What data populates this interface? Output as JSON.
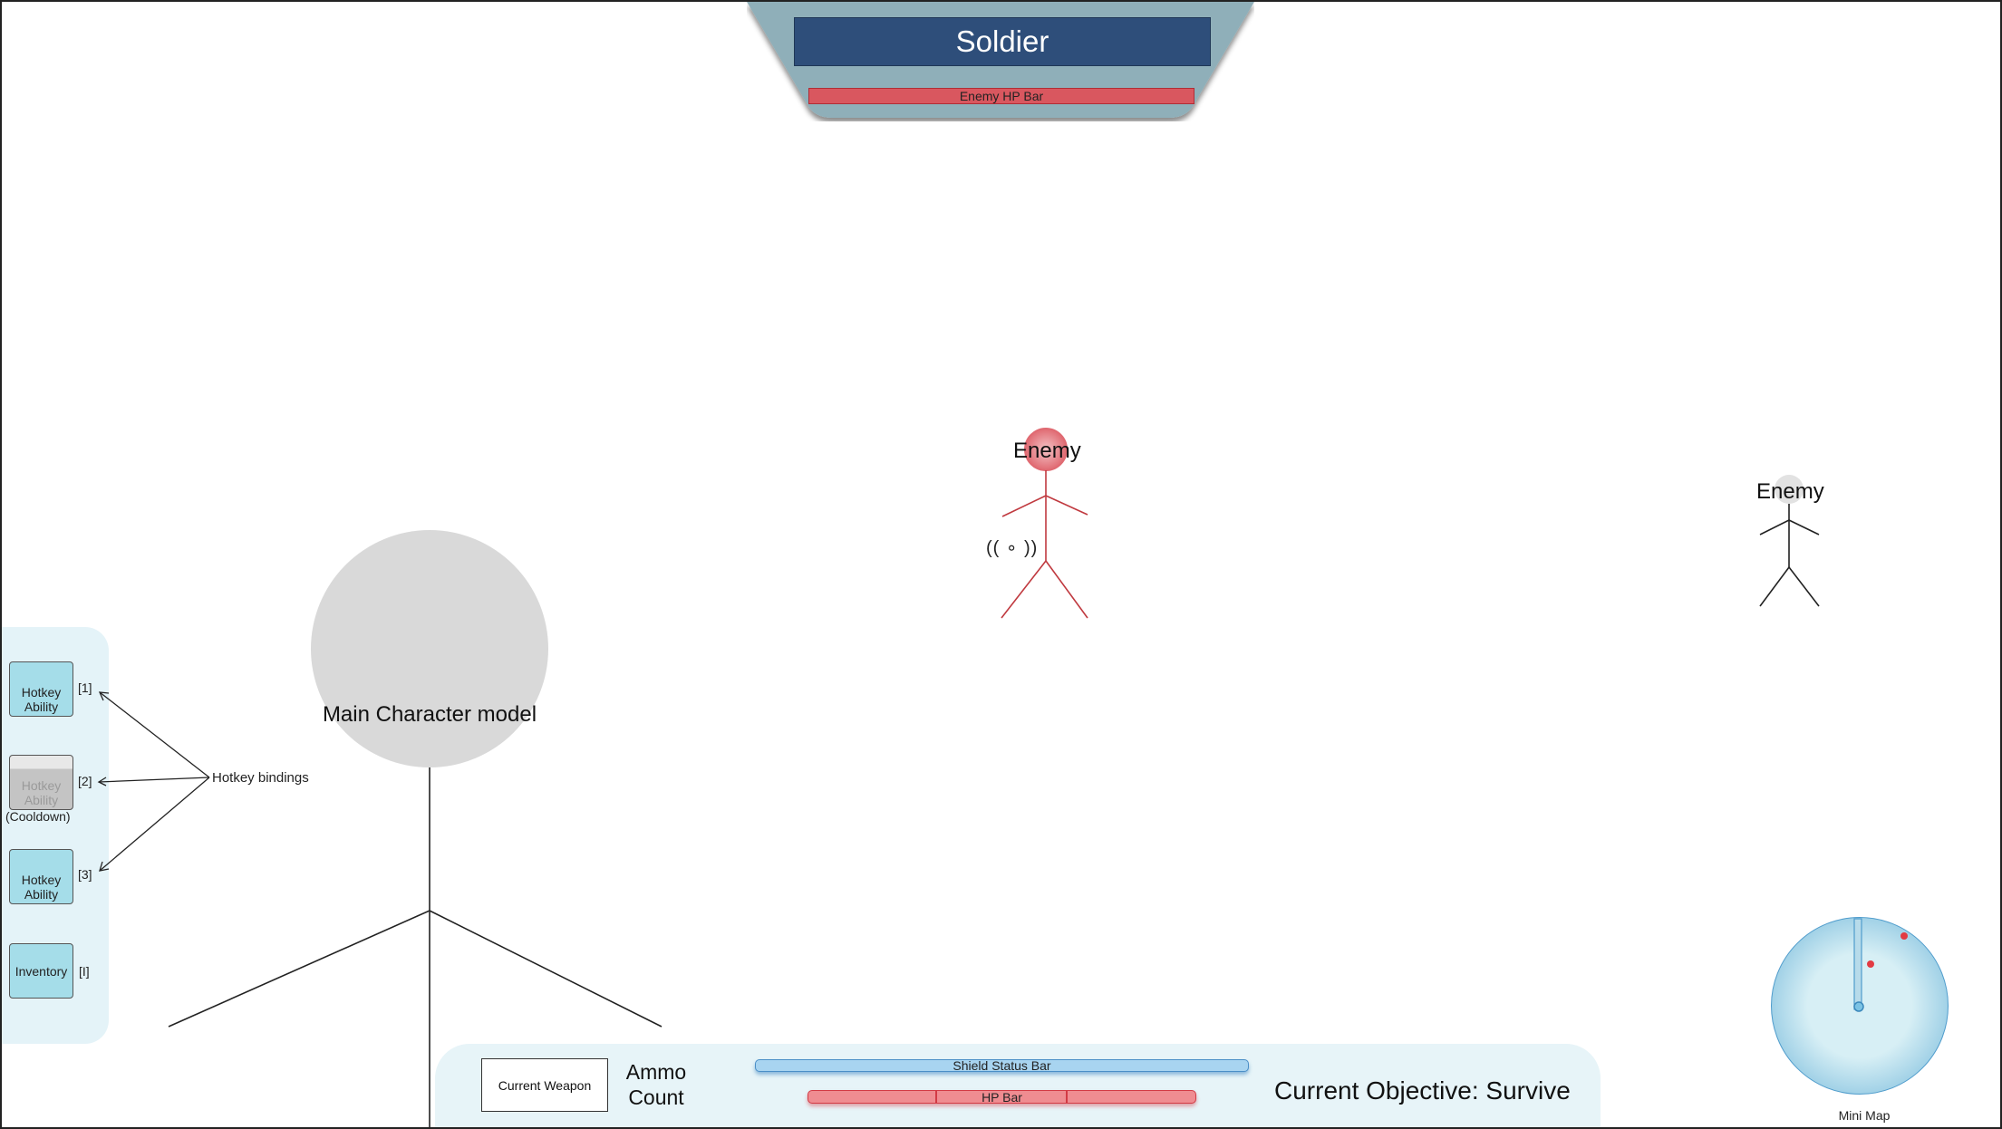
{
  "target": {
    "name": "Soldier",
    "hp_label": "Enemy HP Bar"
  },
  "enemies": [
    {
      "label": "Enemy",
      "state": "targeted"
    },
    {
      "label": "Enemy",
      "state": "idle"
    }
  ],
  "ammo_indicator": "(( ∘ ))",
  "main_character": {
    "label": "Main Character model"
  },
  "hotkeys": [
    {
      "label": "Hotkey Ability",
      "key": "[1]",
      "state": "ready"
    },
    {
      "label": "Hotkey Ability",
      "key": "[2]",
      "state": "cooldown",
      "note": "(Cooldown)"
    },
    {
      "label": "Hotkey Ability",
      "key": "[3]",
      "state": "ready"
    },
    {
      "label": "Inventory",
      "key": "[I]",
      "state": "ready"
    }
  ],
  "hotkey_bindings_label": "Hotkey bindings",
  "hud": {
    "current_weapon": "Current Weapon",
    "ammo_count": "Ammo Count",
    "shield_label": "Shield Status Bar",
    "hp_label": "HP Bar",
    "objective": "Current Objective: Survive"
  },
  "minimap": {
    "label": "Mini Map"
  },
  "colors": {
    "target_panel": "#8fafb9",
    "target_name_bg": "#2e4e7a",
    "enemy_hp": "#d9575f",
    "targeted_enemy": "#c0393f",
    "hotkey_ready": "#a5dde9",
    "hotkey_cooldown": "#c4c4c4",
    "shield": "#a8d4f0",
    "hp": "#ef8c91",
    "hud_bg": "#e7f4f8",
    "minimap": "#9fd0e6",
    "minimap_enemy_dot": "#e23b43"
  }
}
